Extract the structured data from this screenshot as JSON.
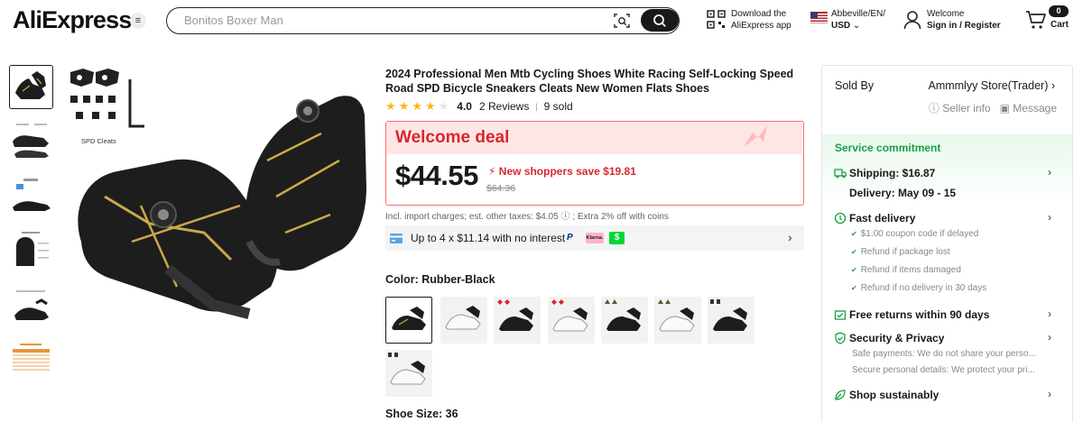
{
  "header": {
    "logo": "AliExpress",
    "search_placeholder": "Bonitos Boxer Man",
    "download_line1": "Download the",
    "download_line2": "AliExpress app",
    "region_line1": "Abbeville/EN/",
    "region_line2": "USD",
    "welcome_line1": "Welcome",
    "welcome_line2": "Sign in / Register",
    "cart_count": "0",
    "cart_label": "Cart"
  },
  "gallery": {
    "cleats_caption": "SPD Cleats"
  },
  "product": {
    "title": "2024 Professional Men Mtb Cycling Shoes White Racing Self-Locking Speed Road SPD Bicycle Sneakers Cleats New Women Flats Shoes",
    "rating_score": "4.0",
    "reviews": "2 Reviews",
    "sold": "9 sold",
    "rating_value": 4.0,
    "deal_title": "Welcome deal",
    "price": "$44.55",
    "new_shopper_save": "New shoppers save $19.81",
    "original_price": "$64.36",
    "tax_note": "Incl. import charges; est. other taxes: $4.05 ⓘ ; Extra 2% off with coins",
    "installment_text": "Up to 4 x $11.14 with no interest",
    "color_label": "Color: Rubber-Black",
    "size_label": "Shoe Size: 36"
  },
  "seller": {
    "sold_by": "Sold By",
    "store_name": "Ammmlyy Store(Trader) ›",
    "seller_info": "ⓘ Seller info",
    "message": "▣ Message"
  },
  "service": {
    "title": "Service commitment",
    "shipping": "Shipping: $16.87",
    "delivery": "Delivery: May 09 - 15",
    "fast_delivery": "Fast delivery",
    "fast_items": [
      "$1.00 coupon code if delayed",
      "Refund if package lost",
      "Refund if items damaged",
      "Refund if no delivery in 30 days"
    ],
    "free_returns": "Free returns within 90 days",
    "security": "Security & Privacy",
    "security_items": [
      "Safe payments: We do not share your perso...",
      "Secure personal details: We protect your pri..."
    ],
    "sustainably": "Shop sustainably"
  },
  "colors": {
    "accent_red": "#d9262f",
    "service_green": "#1a9e45",
    "star": "#fdb813"
  }
}
